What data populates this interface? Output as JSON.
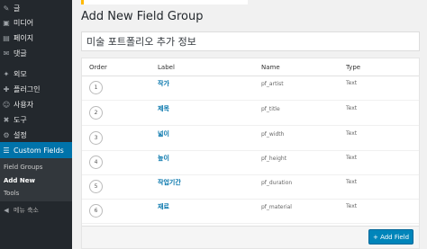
{
  "sidebar": {
    "items": [
      {
        "icon": "pin-icon",
        "glyph": "✎",
        "label": "글"
      },
      {
        "icon": "media-icon",
        "glyph": "▣",
        "label": "미디어"
      },
      {
        "icon": "page-icon",
        "glyph": "▤",
        "label": "페이지"
      },
      {
        "icon": "comment-icon",
        "glyph": "✉",
        "label": "댓글"
      },
      {
        "icon": "appearance-icon",
        "glyph": "✦",
        "label": "외모"
      },
      {
        "icon": "plugin-icon",
        "glyph": "✚",
        "label": "플러그인"
      },
      {
        "icon": "users-icon",
        "glyph": "☺",
        "label": "사용자"
      },
      {
        "icon": "tools-icon",
        "glyph": "✖",
        "label": "도구"
      },
      {
        "icon": "settings-icon",
        "glyph": "⚙",
        "label": "설정"
      },
      {
        "icon": "custom-fields-icon",
        "glyph": "☰",
        "label": "Custom Fields"
      }
    ],
    "submenu": [
      "Field Groups",
      "Add New",
      "Tools"
    ],
    "collapse": {
      "glyph": "◀",
      "label": "메뉴 축소"
    }
  },
  "page": {
    "title": "Add New Field Group",
    "group_title_value": "미술 포트폴리오 추가 정보"
  },
  "fields_table": {
    "headers": {
      "order": "Order",
      "label": "Label",
      "name": "Name",
      "type": "Type"
    },
    "rows": [
      {
        "order": "1",
        "label": "작가",
        "name": "pf_artist",
        "type": "Text"
      },
      {
        "order": "2",
        "label": "제목",
        "name": "pf_title",
        "type": "Text"
      },
      {
        "order": "3",
        "label": "넓이",
        "name": "pf_width",
        "type": "Text"
      },
      {
        "order": "4",
        "label": "높이",
        "name": "pf_height",
        "type": "Text"
      },
      {
        "order": "5",
        "label": "작업기간",
        "name": "pf_duration",
        "type": "Text"
      },
      {
        "order": "6",
        "label": "재료",
        "name": "pf_material",
        "type": "Text"
      }
    ],
    "add_button": "+ Add Field"
  },
  "colors": {
    "sidebar_bg": "#23282d",
    "accent": "#0073aa",
    "button": "#0085ba",
    "notice": "#ffb900"
  }
}
